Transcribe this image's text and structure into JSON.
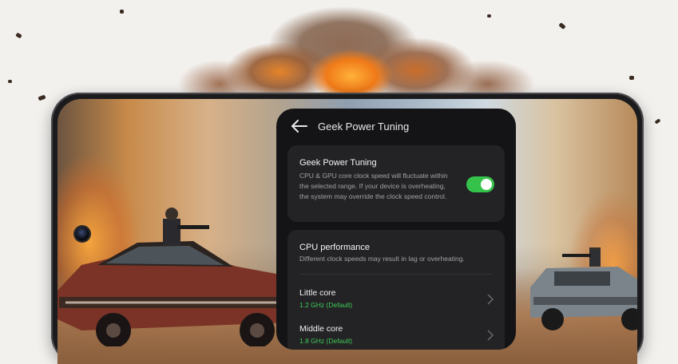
{
  "panel": {
    "title": "Geek Power Tuning",
    "power_card": {
      "title": "Geek Power Tuning",
      "description": "CPU & GPU core clock speed will fluctuate within the selected range. If your device is overheating, the system may override the clock speed control.",
      "toggle_on": true
    },
    "cpu_card": {
      "title": "CPU performance",
      "description": "Different clock speeds may result in lag or overheating.",
      "rows": [
        {
          "label": "Little core",
          "value": "1.2 GHz  (Default)"
        },
        {
          "label": "Middle core",
          "value": "1.8 GHz  (Default)"
        }
      ]
    }
  },
  "colors": {
    "accent_green": "#34c24a",
    "value_green": "#3fcb54",
    "panel_bg": "#141416",
    "card_bg": "#232326"
  },
  "icons": [
    "back-arrow-icon",
    "chevron-right-icon"
  ]
}
